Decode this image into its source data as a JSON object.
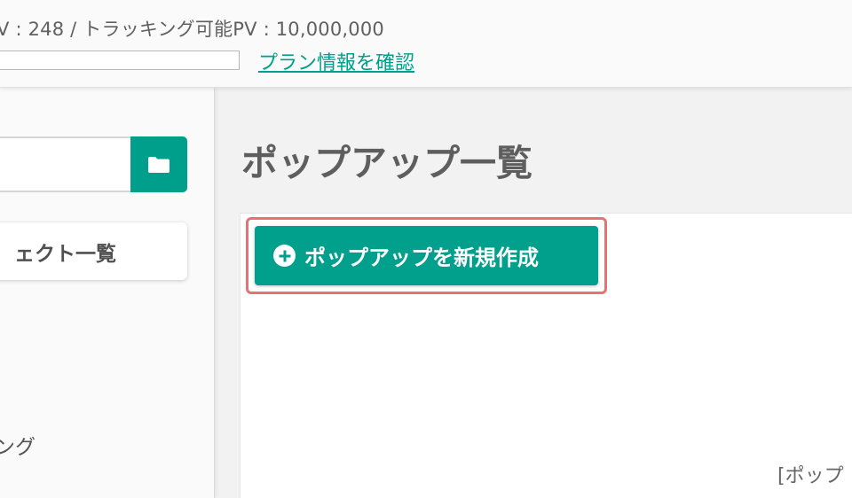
{
  "header": {
    "pv_text": "V : 248  /  トラッキング可能PV : 10,000,000",
    "usage_percent": 0,
    "plan_link_label": "プラン情報を確認"
  },
  "sidebar": {
    "search_value": "",
    "folder_icon": "folder-icon",
    "project_list_label": "ェクト一覧",
    "partial_item_label": "ング"
  },
  "main": {
    "page_title": "ポップアップ一覧",
    "create_button_label": "ポップアップを新規作成",
    "create_icon": "plus-circle-icon",
    "bottom_partial_text": "[ポップ"
  },
  "colors": {
    "accent": "#009f8b",
    "highlight_border": "#e57373",
    "background": "#f2f2f2"
  }
}
